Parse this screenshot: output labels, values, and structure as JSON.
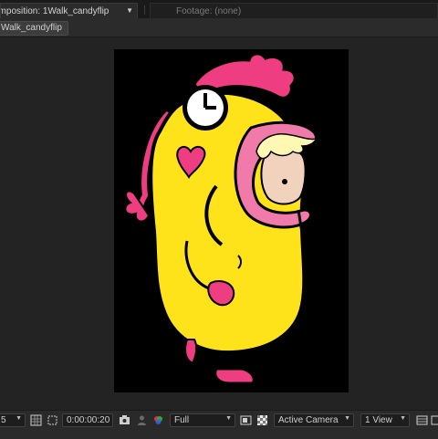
{
  "tabs": {
    "composition_label": "omposition: 1Walk_candyflip",
    "footage_label": "Footage: (none)"
  },
  "comp_chip": "Walk_candyflip",
  "toolbar": {
    "magnification_partial": "5",
    "timecode": "0:00:00:20",
    "resolution": "Full",
    "camera": "Active Camera",
    "views": "1 View"
  },
  "icons": {
    "tab_dropdown": "chevron-down-icon",
    "snapshot": "camera-icon",
    "show_snapshot": "person-icon",
    "channel": "rgb-channels-icon",
    "region_of_interest": "roi-icon",
    "transparency_grid": "checkerboard-icon",
    "grid_guides": "grid-icon"
  },
  "colors": {
    "panel_bg": "#232323",
    "canvas_bg": "#000000",
    "character_yellow": "#ffe31a",
    "character_pink": "#ee3d80",
    "skin": "#f1d2bd",
    "hair": "#fff8b4"
  }
}
